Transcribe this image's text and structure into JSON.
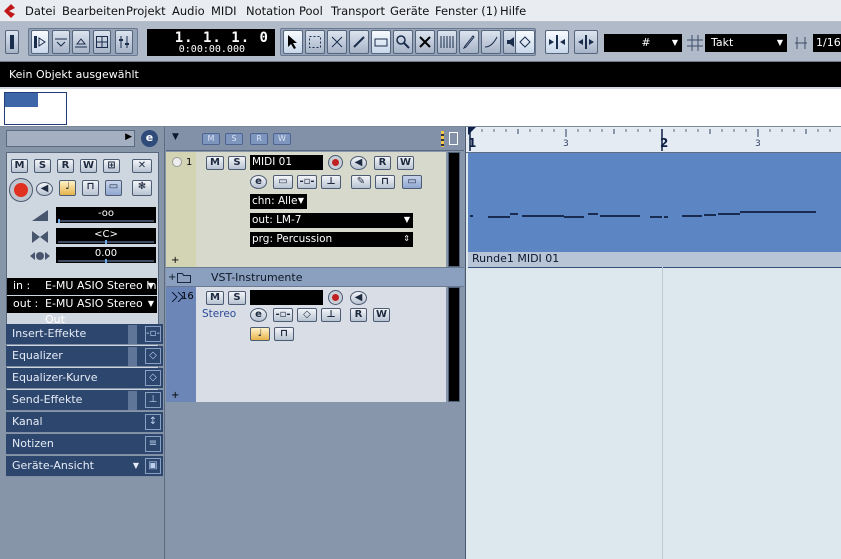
{
  "menu": [
    "Datei",
    "Bearbeiten",
    "Projekt",
    "Audio",
    "MIDI",
    "Notation",
    "Pool",
    "Transport",
    "Geräte",
    "Fenster (1)",
    "Hilfe"
  ],
  "transport": {
    "bars": "1.  1.  1.     0",
    "time": "0:00:00.000"
  },
  "toolbar": {
    "grid_type": "Takt",
    "quantize": "1/16"
  },
  "infoline": {
    "text": "Kein Objekt ausgewählt"
  },
  "inspector": {
    "buttons": [
      "M",
      "S",
      "R",
      "W"
    ],
    "volume": "-oo",
    "pan": "<C>",
    "delay": "0.00",
    "in_label": "in :",
    "in_value": "E-MU ASIO Stereo In",
    "out_label": "out :",
    "out_value": "E-MU ASIO Stereo Out",
    "sections": [
      "Insert-Effekte",
      "Equalizer",
      "Equalizer-Kurve",
      "Send-Effekte",
      "Kanal",
      "Notizen",
      "Geräte-Ansicht"
    ]
  },
  "tracks": {
    "t1": {
      "number": "1",
      "name": "MIDI 01",
      "channel": "chn: Alle",
      "output": "out: LM-7",
      "program": "prg: Percussion"
    },
    "folder": {
      "name": "VST-Instrumente"
    },
    "t16": {
      "number": "16",
      "name": "",
      "type": "Stereo"
    }
  },
  "ruler": {
    "bar1": "1",
    "bar2": "2",
    "sub1": "3",
    "sub2": "3"
  },
  "part": {
    "label": "Runde1 MIDI 01"
  },
  "colors": {
    "midi_part": "#5c86c3",
    "track_sel": "#d2d4b4",
    "record": "#e03020"
  }
}
